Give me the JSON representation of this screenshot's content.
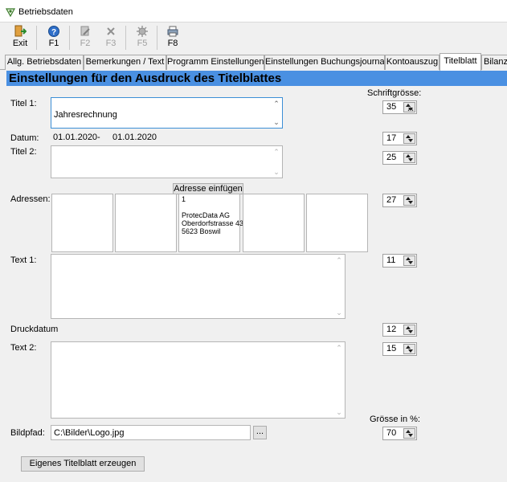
{
  "window": {
    "title": "Betriebsdaten",
    "icon": "app-icon"
  },
  "toolbar": {
    "buttons": [
      {
        "label": "Exit",
        "icon": "exit-icon",
        "enabled": true
      },
      {
        "label": "F1",
        "icon": "help-icon",
        "enabled": true
      },
      {
        "label": "F2",
        "icon": "edit-icon",
        "enabled": false
      },
      {
        "label": "F3",
        "icon": "delete-icon",
        "enabled": false
      },
      {
        "label": "F5",
        "icon": "settings-icon",
        "enabled": false
      },
      {
        "label": "F8",
        "icon": "print-icon",
        "enabled": true
      }
    ]
  },
  "tabs": [
    {
      "label": "Allg. Betriebsdaten"
    },
    {
      "label": "Bemerkungen / Text"
    },
    {
      "label": "Programm Einstellungen"
    },
    {
      "label": "Einstellungen Buchungsjournal"
    },
    {
      "label": "Kontoauszug"
    },
    {
      "label": "Titelblatt",
      "active": true
    },
    {
      "label": "Bilanz"
    }
  ],
  "panel": {
    "header": "Einstellungen für den Ausdruck des Titelblattes",
    "font_size_label": "Schriftgrösse:",
    "title1": {
      "label": "Titel 1:",
      "value": "Jahresrechnung",
      "font_size": "35"
    },
    "date": {
      "label": "Datum:",
      "from": "01.01.2020",
      "separator": "-",
      "to": "01.01.2020",
      "font_size": "17"
    },
    "title2": {
      "label": "Titel 2:",
      "value": "",
      "font_size": "25"
    },
    "addresses": {
      "label": "Adressen:",
      "insert_button": "Adresse einfügen",
      "font_size": "27",
      "boxes": [
        {
          "lines": []
        },
        {
          "lines": []
        },
        {
          "lines": [
            "1",
            "",
            "ProtecData AG",
            "Oberdorfstrasse 43",
            "5623 Boswil"
          ]
        },
        {
          "lines": []
        },
        {
          "lines": []
        }
      ]
    },
    "text1": {
      "label": "Text 1:",
      "value": "",
      "font_size": "11"
    },
    "print_date": {
      "label": "Druckdatum",
      "font_size": "12"
    },
    "text2": {
      "label": "Text 2:",
      "value": "",
      "font_size": "15"
    },
    "image": {
      "label": "Bildpfad:",
      "value": "C:\\Bilder\\Logo.jpg",
      "browse_label": "...",
      "size_label": "Grösse in %:",
      "size_value": "70"
    },
    "create_button": "Eigenes Titelblatt erzeugen"
  }
}
